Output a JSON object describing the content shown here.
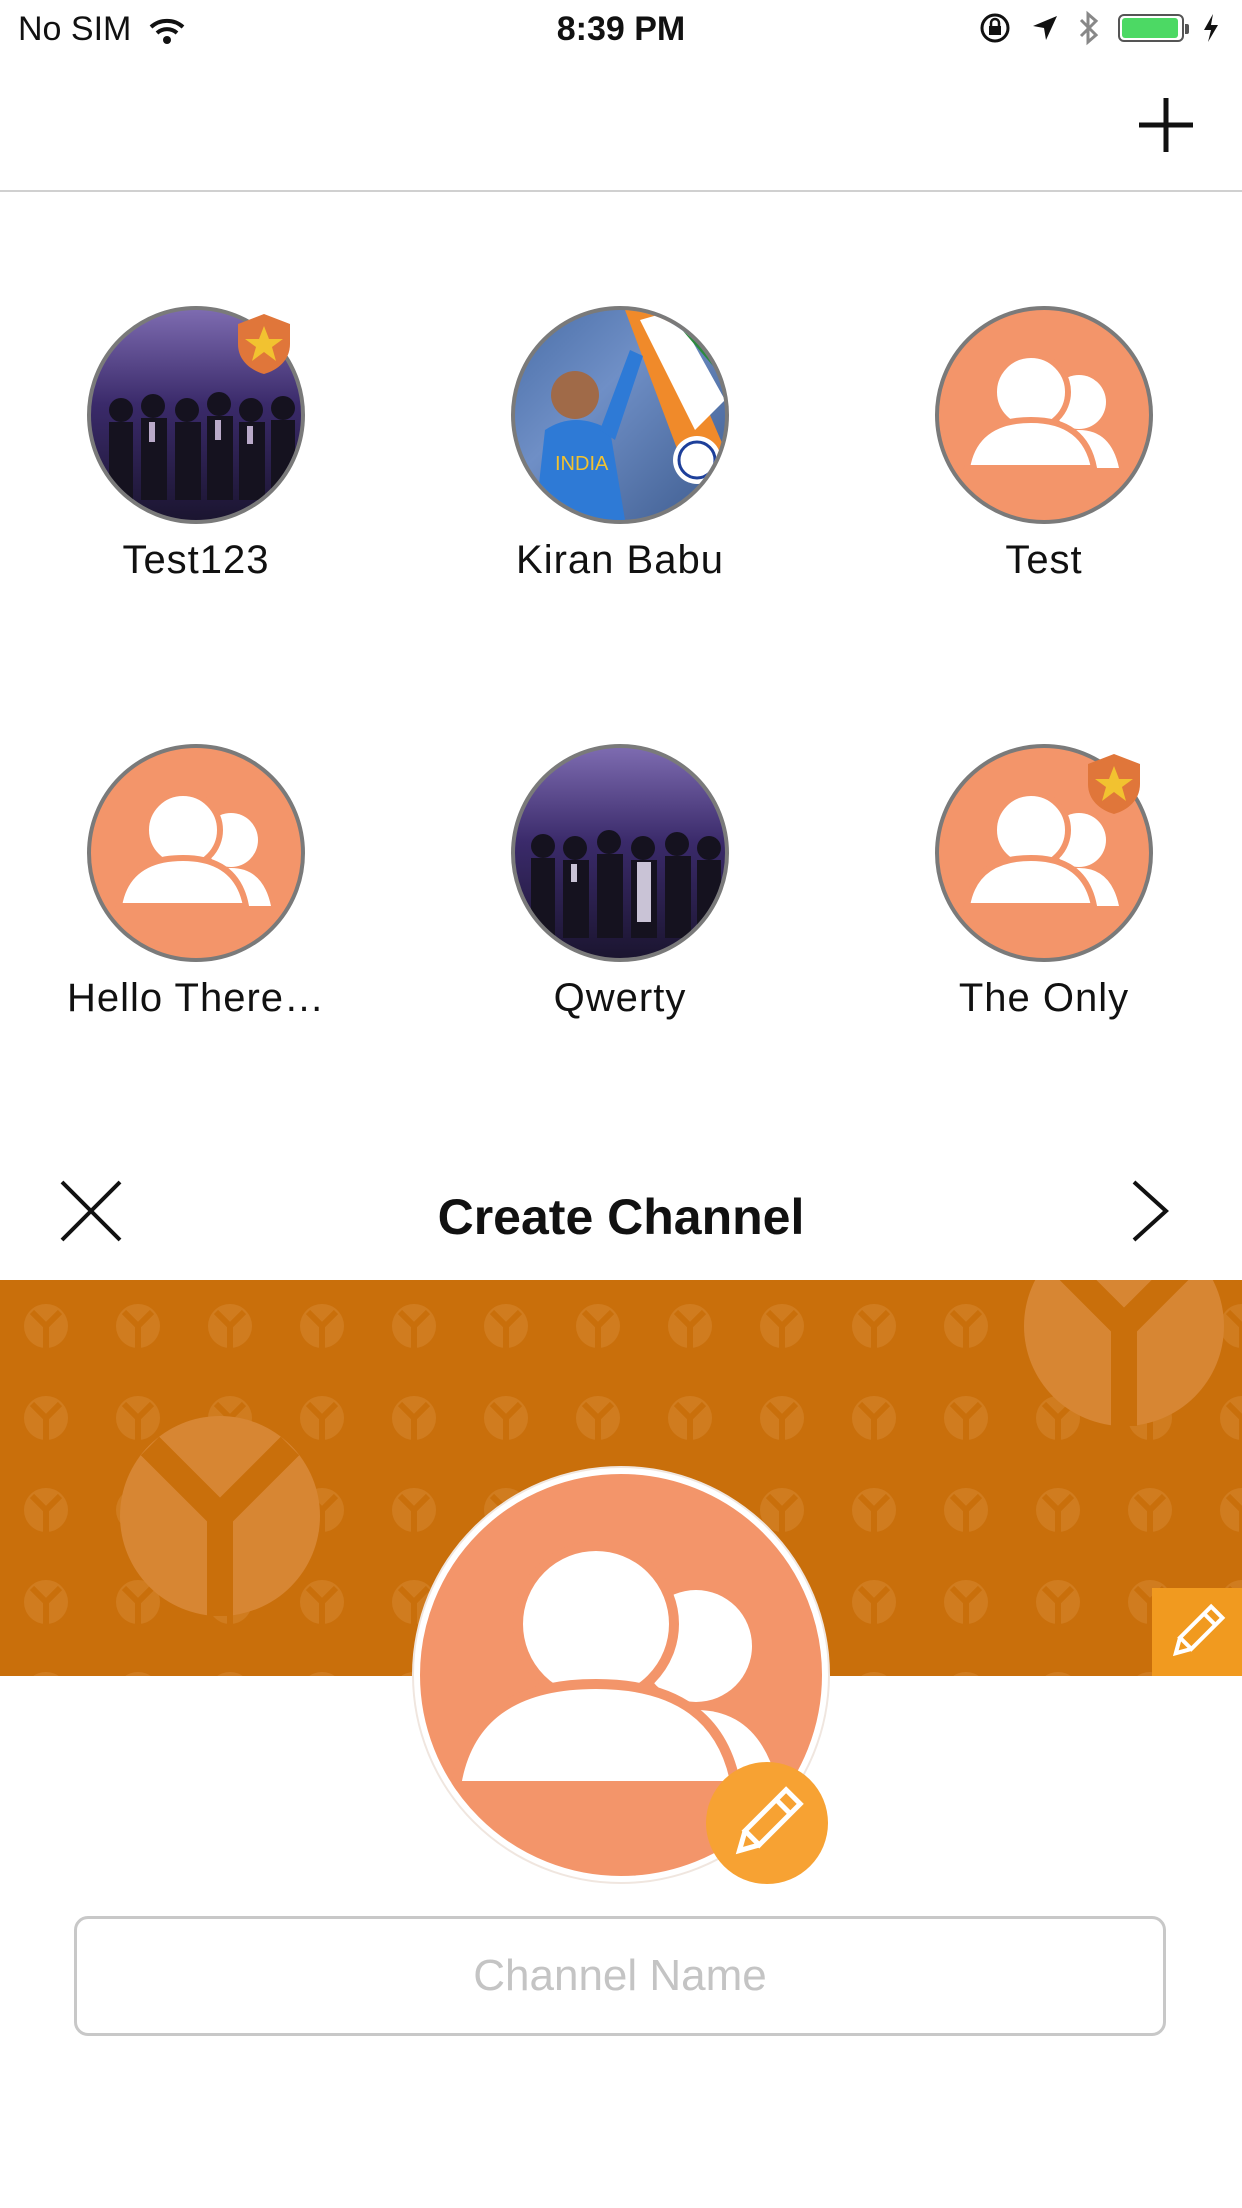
{
  "status_bar": {
    "carrier": "No SIM",
    "time": "8:39 PM",
    "battery_color": "#4cd964"
  },
  "nav": {
    "add_icon": "plus-icon"
  },
  "channels": [
    {
      "name": "Test123",
      "avatar": "photo-crowd",
      "admin_badge": true
    },
    {
      "name": "Kiran Babu",
      "avatar": "photo-cricket",
      "admin_badge": false
    },
    {
      "name": "Test",
      "avatar": "group-icon",
      "admin_badge": false
    },
    {
      "name": "Hello There…",
      "avatar": "group-icon",
      "admin_badge": false
    },
    {
      "name": "Qwerty",
      "avatar": "photo-crowd",
      "admin_badge": false
    },
    {
      "name": "The Only",
      "avatar": "group-icon",
      "admin_badge": true
    }
  ],
  "create_channel": {
    "title": "Create Channel",
    "close_icon": "close-icon",
    "next_icon": "chevron-right-icon",
    "cover_color": "#c96f0b",
    "avatar_color": "#f3956a",
    "edit_color": "#f7a233",
    "name_placeholder": "Channel Name",
    "name_value": ""
  }
}
